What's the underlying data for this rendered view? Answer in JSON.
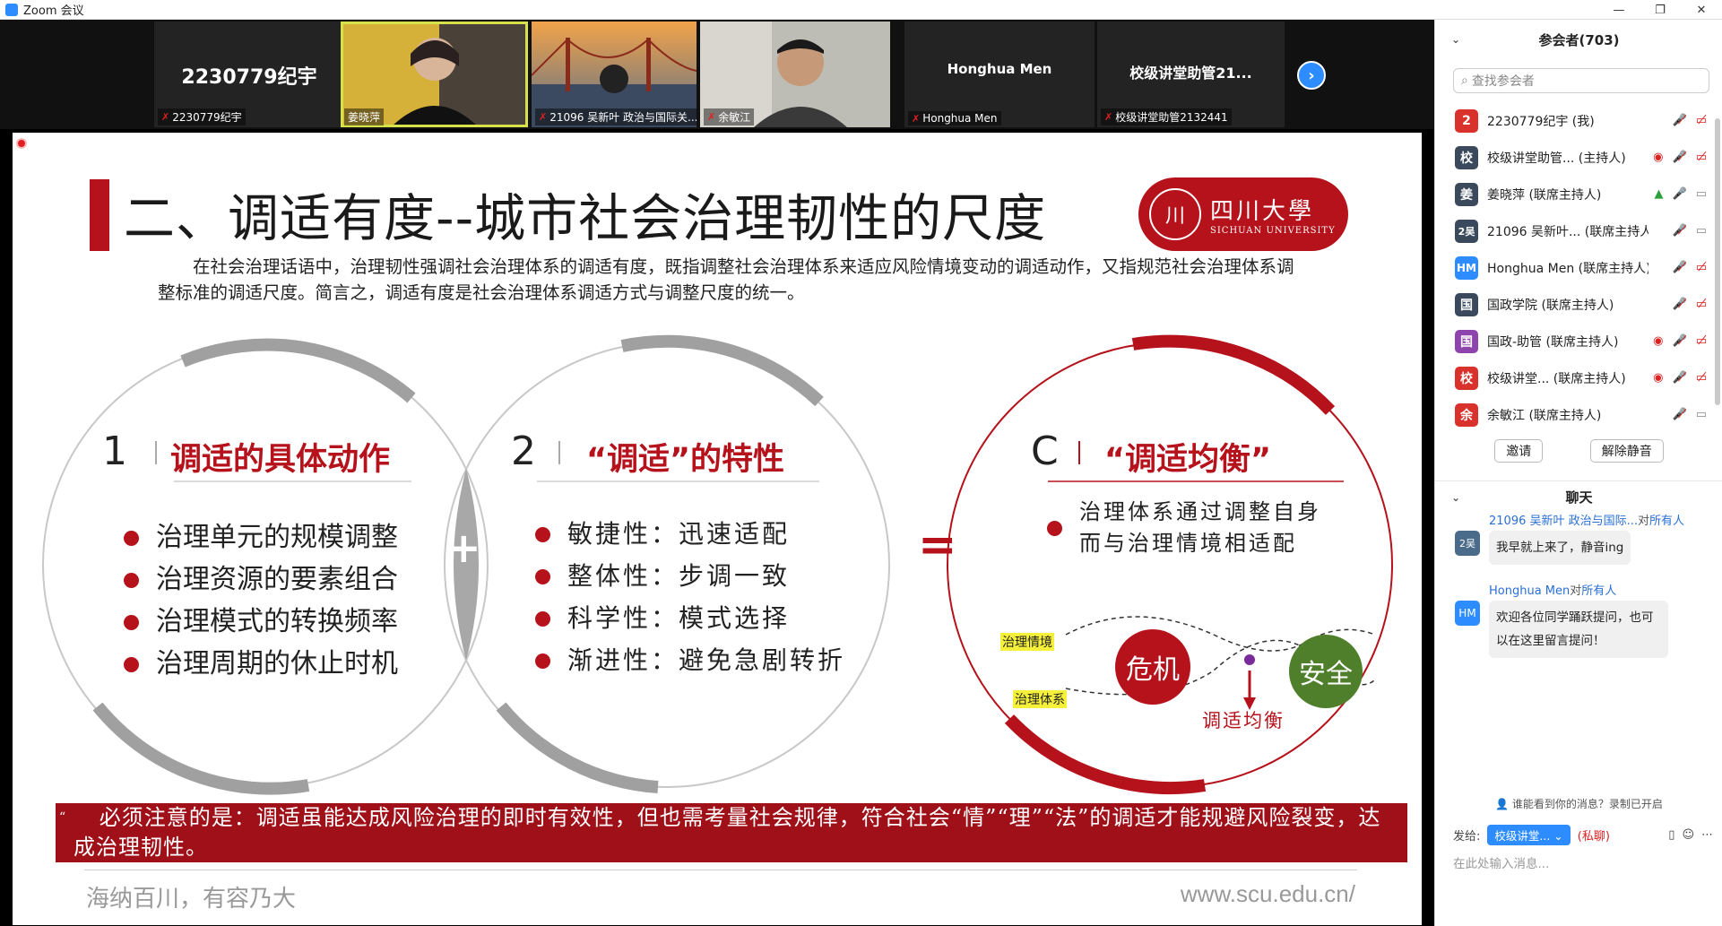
{
  "window": {
    "title": "Zoom 会议",
    "buttons": [
      "—",
      "❐",
      "✕"
    ]
  },
  "gallery": {
    "tiles": [
      {
        "big_name": "2230779纪宇",
        "label": "2230779纪宇"
      },
      {
        "label": "姜晓萍"
      },
      {
        "label": "21096 吴新叶 政治与国际关..."
      },
      {
        "label": "余敏江"
      },
      {
        "big_name": "Honghua Men",
        "label": "Honghua Men"
      },
      {
        "big_name": "校级讲堂助管21...",
        "label": "校级讲堂助管2132441"
      }
    ],
    "next_icon": "›"
  },
  "slide": {
    "title": "二、调适有度--城市社会治理韧性的尺度",
    "logo": {
      "cn": "四川大學",
      "en": "SICHUAN UNIVERSITY",
      "seal": "川"
    },
    "intro": "在社会治理话语中，治理韧性强调社会治理体系的调适有度，既指调整社会治理体系来适应风险情境变动的调适动作，又指规范社会治理体系调整标准的调适尺度。简言之，调适有度是社会治理体系调适方式与调整尺度的统一。",
    "circles": [
      {
        "num": "1",
        "title": "调适的具体动作",
        "items": [
          "治理单元的规模调整",
          "治理资源的要素组合",
          "治理模式的转换频率",
          "治理周期的休止时机"
        ]
      },
      {
        "num": "2",
        "title": "“调适”的特性",
        "items": [
          "敏捷性：迅速适配",
          "整体性：步调一致",
          "科学性：模式选择",
          "渐进性：避免急剧转折"
        ]
      },
      {
        "num": "C",
        "title": "“调适均衡”",
        "items": [
          "治理体系通过调整自身而与治理情境相适配"
        ]
      }
    ],
    "plus": "+",
    "equals": "=",
    "balance": {
      "label_situation": "治理情境",
      "label_system": "治理体系",
      "crisis": "危机",
      "safety": "安全",
      "caption": "调适均衡"
    },
    "note": "必须注意的是：调适虽能达成风险治理的即时有效性，但也需考量社会规律，符合社会“情”“理”“法”的调适才能规避风险裂变，达成治理韧性。",
    "note_marks": [
      "“",
      "”"
    ],
    "motto": "海纳百川，有容乃大",
    "site": "www.scu.edu.cn/"
  },
  "participants": {
    "header": "参会者(703)",
    "search_placeholder": "查找参会者",
    "list": [
      {
        "avatar": "2",
        "color": "#d9312b",
        "name": "2230779纪宇 (我)",
        "icons": [
          "🎤̸",
          "▭̸"
        ]
      },
      {
        "avatar": "校",
        "color": "#3a4a5c",
        "name": "校级讲堂助管... (主持人)",
        "icons": [
          "◉",
          "🎤̸",
          "▭̸"
        ]
      },
      {
        "avatar": "姜",
        "color": "#3a4a5c",
        "name": "姜晓萍 (联席主持人)",
        "icons": [
          "▲",
          "🎤",
          "▭"
        ]
      },
      {
        "avatar": "2吴",
        "color": "#3a4a5c",
        "name": "21096 吴新叶... (联席主持人)",
        "icons": [
          "🎤̸",
          "▭"
        ]
      },
      {
        "avatar": "HM",
        "color": "#2d8cff",
        "name": "Honghua Men (联席主持人)",
        "icons": [
          "🎤̸",
          "▭̸"
        ]
      },
      {
        "avatar": "国",
        "color": "#3a4a5c",
        "name": "国政学院 (联席主持人)",
        "icons": [
          "🎤̸",
          "▭̸"
        ]
      },
      {
        "avatar": "国",
        "color": "#8e44ad",
        "name": "国政-助管 (联席主持人)",
        "icons": [
          "◉",
          "🎤̸",
          "▭̸"
        ]
      },
      {
        "avatar": "校",
        "color": "#d9312b",
        "name": "校级讲堂... (联席主持人)",
        "icons": [
          "◉",
          "🎤̸",
          "▭̸"
        ]
      },
      {
        "avatar": "余",
        "color": "#d9312b",
        "name": "余敏江 (联席主持人)",
        "icons": [
          "🎤̸",
          "▭"
        ]
      }
    ],
    "invite": "邀请",
    "unmute": "解除静音"
  },
  "chat": {
    "header": "聊天",
    "messages": [
      {
        "from": "21096 吴新叶 政治与国际...",
        "to_prefix": "对",
        "to": "所有人",
        "avatar": "2吴",
        "text": "我早就上来了，静音ing"
      },
      {
        "from": "Honghua Men",
        "to_prefix": "对",
        "to": "所有人",
        "avatar": "HM",
        "text": "欢迎各位同学踊跃提问，也可以在这里留言提问！"
      }
    ],
    "privacy": "谁能看到你的消息？录制已开启",
    "send_label": "发给:",
    "send_to": "校级讲堂... ⌄",
    "private": "(私聊)",
    "input_placeholder": "在此处输入消息..."
  },
  "colors": {
    "accent_red": "#b5121b",
    "zoom_blue": "#2d8cff",
    "safety_green": "#4f7f2a"
  }
}
